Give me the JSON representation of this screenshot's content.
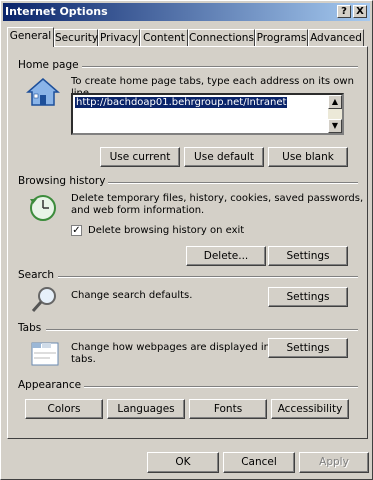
{
  "window": {
    "title": "Internet Options",
    "help_glyph": "?",
    "close_glyph": "X"
  },
  "tabs": [
    "General",
    "Security",
    "Privacy",
    "Content",
    "Connections",
    "Programs",
    "Advanced"
  ],
  "home_page": {
    "label": "Home page",
    "description": "To create home page tabs, type each address on its own line.",
    "url": "http://bachdoap01.behrgroup.net/Intranet",
    "buttons": {
      "use_current": "Use current",
      "use_default": "Use default",
      "use_blank": "Use blank"
    }
  },
  "browsing_history": {
    "label": "Browsing history",
    "description_line1": "Delete temporary files, history, cookies, saved passwords,",
    "description_line2": "and web form information.",
    "checkbox_label": "Delete browsing history on exit",
    "checkbox_checked": true,
    "check_glyph": "✓",
    "delete_button": "Delete...",
    "settings_button": "Settings"
  },
  "search": {
    "label": "Search",
    "description": "Change search defaults.",
    "settings_button": "Settings"
  },
  "tabs_section": {
    "label": "Tabs",
    "description_line1": "Change how webpages are displayed in",
    "description_line2": "tabs.",
    "settings_button": "Settings"
  },
  "appearance": {
    "label": "Appearance",
    "buttons": {
      "colors": "Colors",
      "languages": "Languages",
      "fonts": "Fonts",
      "accessibility": "Accessibility"
    }
  },
  "footer": {
    "ok": "OK",
    "cancel": "Cancel",
    "apply": "Apply"
  }
}
